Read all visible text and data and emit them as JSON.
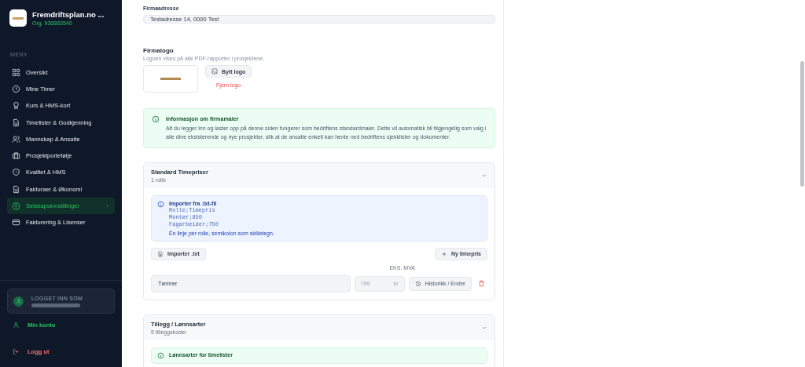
{
  "sidebar": {
    "company": {
      "name": "Fremdriftsplan.no ...",
      "org": "Org. 936883540"
    },
    "menu_label": "MENY",
    "items": [
      {
        "label": "Oversikt",
        "selected": false
      },
      {
        "label": "Mine Timer",
        "selected": false
      },
      {
        "label": "Kurs & HMS-kort",
        "selected": false
      },
      {
        "label": "Timelister & Godkjenning",
        "selected": false
      },
      {
        "label": "Mannskap & Ansatte",
        "selected": false
      },
      {
        "label": "Prosjektportefølje",
        "selected": false
      },
      {
        "label": "Kvalitet & HMS",
        "selected": false
      },
      {
        "label": "Fakturaer & Økonomi",
        "selected": false
      },
      {
        "label": "Selskapsinnstillinger",
        "selected": true
      },
      {
        "label": "Fakturering & Lisenser",
        "selected": false
      }
    ],
    "user": {
      "label": "LOGGET INN SOM"
    },
    "account": "Min konto",
    "logout": "Logg ut"
  },
  "main": {
    "address": {
      "label": "Firmaadresse",
      "value": "Testadresse 14, 0000 Test"
    },
    "logo": {
      "title": "Firmalogo",
      "description": "Logoen vises på alle PDF-rapporter i prosjektene.",
      "change": "Bytt logo",
      "remove": "Fjern logo"
    },
    "info": {
      "title": "Informasjon om firmamaler",
      "text": "Alt du legger inn og laster opp på denne siden fungerer som bedriftens standardmaler. Dette vil automatisk bli tilgjengelig som valg i alle dine eksisterende og nye prosjekter, slik at de ansatte enkelt kan hente ned bedriftens sjekklister og dokumenter."
    },
    "rates": {
      "title": "Standard Timepriser",
      "subtitle": "1 rolle",
      "expanded": true,
      "import_info": {
        "title": "Importer fra .txt-fil",
        "code": [
          "Rolle;Timepris",
          "Montør;850",
          "Fagarbeider;750"
        ],
        "note": "Én linje per rolle, semikolon som skilletegn."
      },
      "import_button": "Importer .txt",
      "new_button": "Ny timepris",
      "column_label": "EKS. MVA",
      "rows": [
        {
          "role": "Tømrer",
          "price": "799",
          "unit": "kr",
          "history": "Historikk / Endre"
        }
      ]
    },
    "supplements": {
      "title": "Tillegg / Lønnsarter",
      "subtitle": "5 tilleggskoder",
      "expanded": true,
      "info_title": "Lønnsarter for timelister"
    }
  }
}
